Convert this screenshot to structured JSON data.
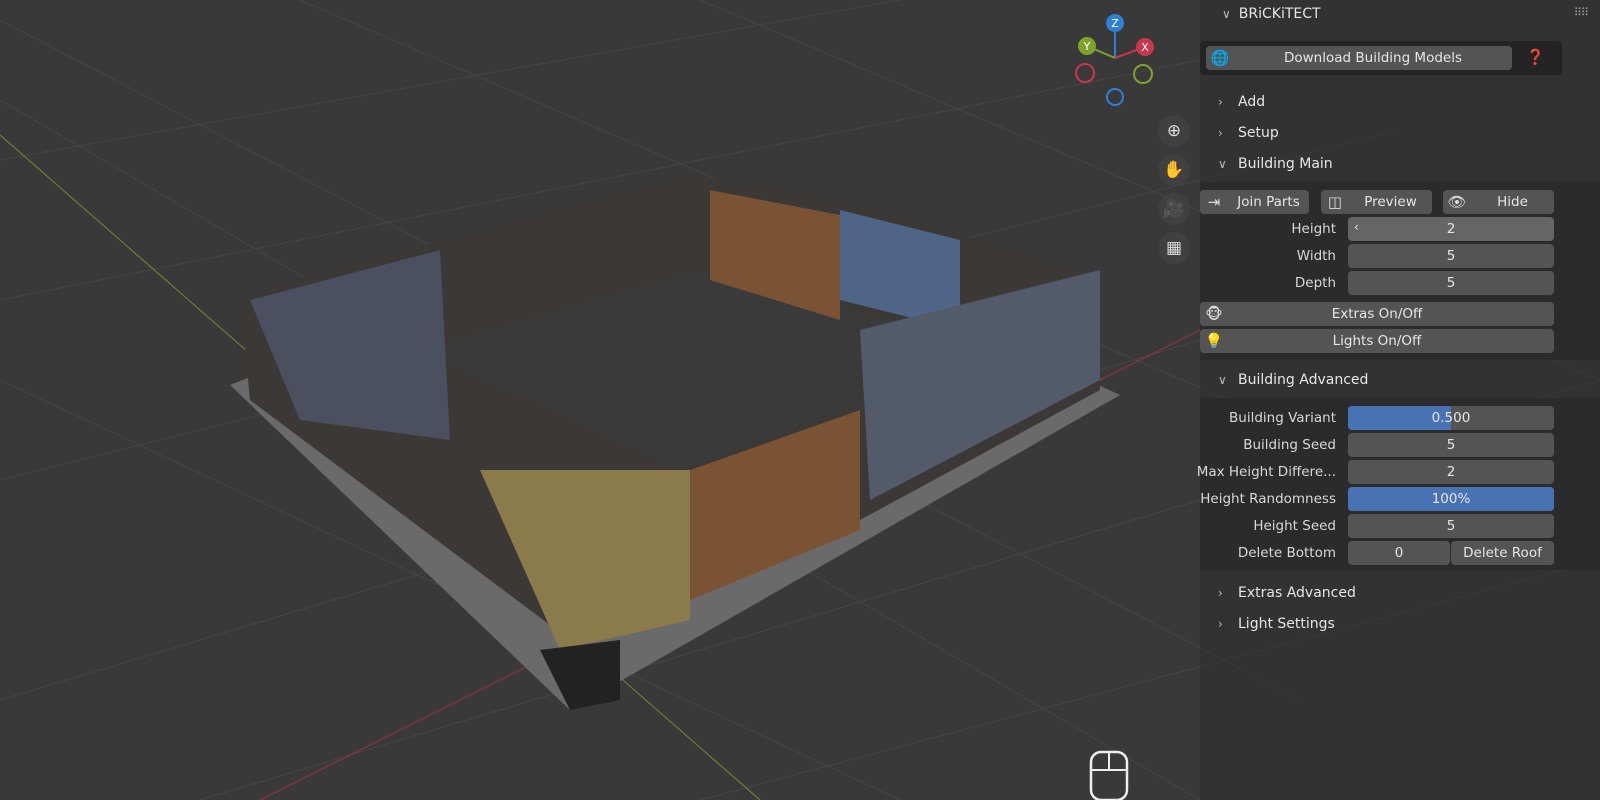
{
  "gizmo": {
    "z": "Z",
    "y": "Y",
    "x": "X"
  },
  "panel": {
    "title": "BRiCKiTECT",
    "download_label": "Download Building Models",
    "sections": {
      "add": "Add",
      "setup": "Setup",
      "building_main": "Building Main",
      "building_advanced": "Building Advanced",
      "extras_advanced": "Extras Advanced",
      "light_settings": "Light Settings"
    },
    "main": {
      "join": "Join Parts",
      "preview": "Preview",
      "hide": "Hide",
      "fields": [
        {
          "label": "Height",
          "value": "2"
        },
        {
          "label": "Width",
          "value": "5"
        },
        {
          "label": "Depth",
          "value": "5"
        }
      ],
      "extras": "Extras On/Off",
      "lights": "Lights On/Off"
    },
    "advanced": {
      "variant": {
        "label": "Building Variant",
        "value": "0.500",
        "fraction": 0.5
      },
      "bseed": {
        "label": "Building  Seed",
        "value": "5"
      },
      "maxh": {
        "label": "Max Height Differe...",
        "value": "2"
      },
      "rand": {
        "label": "Height Randomness",
        "value": "100%",
        "fraction": 1.0
      },
      "hseed": {
        "label": "Height Seed",
        "value": "5"
      },
      "delbottom": {
        "label": "Delete Bottom",
        "value": "0"
      },
      "delroof": "Delete Roof"
    }
  },
  "colors": {
    "accent": "#4772b3",
    "x": "#c8374a",
    "y": "#7fa32a",
    "z": "#2f7fd6"
  }
}
